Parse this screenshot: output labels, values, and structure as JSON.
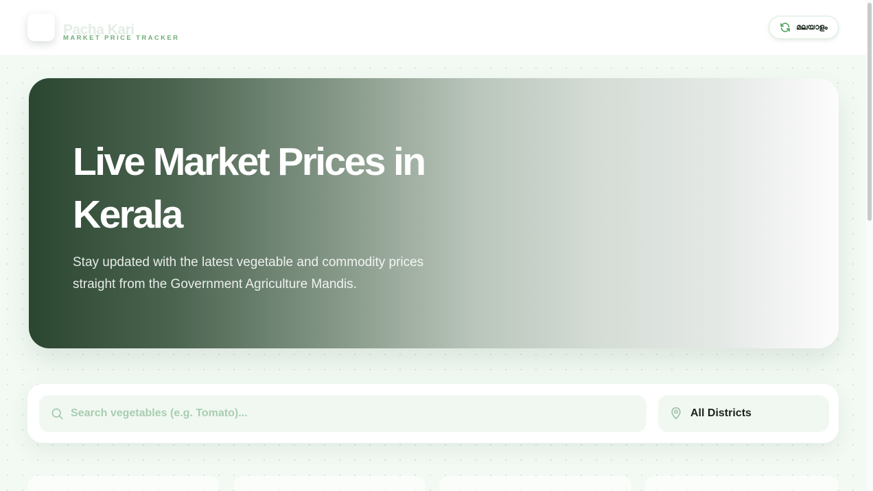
{
  "header": {
    "brand_name": "Pacha Kari",
    "brand_tagline": "MARKET PRICE TRACKER",
    "language_toggle_label": "മലയാളം",
    "language_toggle_icon": "refresh-icon"
  },
  "hero": {
    "title": "Live Market Prices in Kerala",
    "subtitle": "Stay updated with the latest vegetable and commodity prices straight from the Government Agriculture Mandis."
  },
  "filters": {
    "search_placeholder": "Search vegetables (e.g. Tomato)...",
    "search_value": "",
    "search_icon": "search-icon",
    "district_selected": "All Districts",
    "district_icon": "map-pin-icon"
  },
  "colors": {
    "accent": "#3f9a4f",
    "hero_dark": "#2b4630",
    "page_background": "#f3faf4"
  }
}
